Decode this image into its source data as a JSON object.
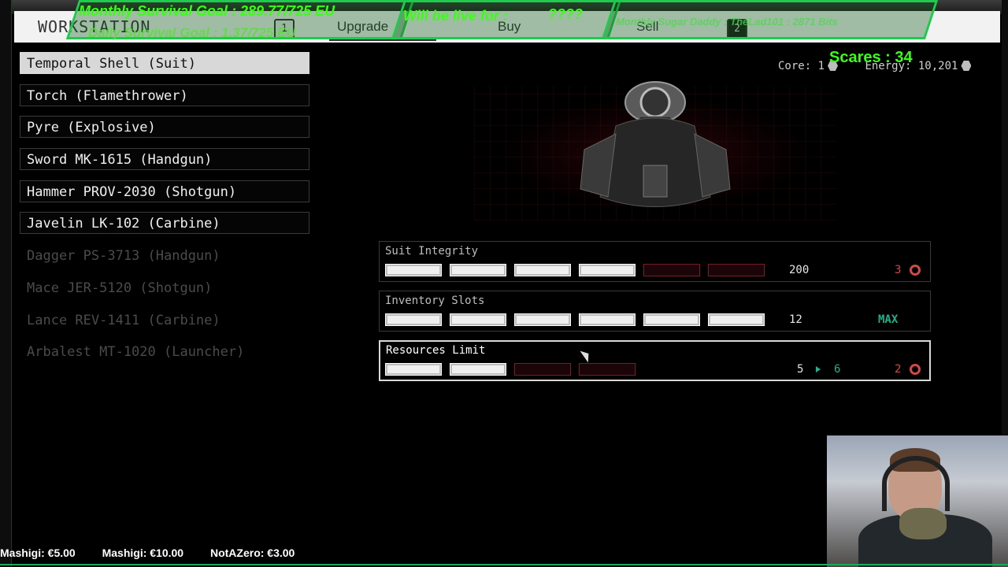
{
  "header": {
    "title": "WORKSTATION",
    "tabs": [
      {
        "key": "1",
        "label": "Upgrade"
      },
      {
        "key": "",
        "label": "Buy"
      },
      {
        "key": "",
        "label": "Sell"
      },
      {
        "key": "2",
        "label": ""
      }
    ]
  },
  "overlays": {
    "monthly_goal": "Monthly Survival Goal : 289.77/725 EU",
    "daily_goal": "Daily Survival Goal : 1.37/725 EU",
    "live_for": "Will be live for :",
    "live_for_value": "????",
    "sugar_daddy": "Monthly Sugar Daddy : TheLad101 : 2871 Bits",
    "scares": "Scares : 34"
  },
  "stats": {
    "core_label": "Core: 1",
    "energy_label": "Energy: 10,201"
  },
  "items": [
    {
      "label": "Temporal Shell (Suit)",
      "state": "selected"
    },
    {
      "label": "Torch (Flamethrower)",
      "state": "owned"
    },
    {
      "label": "Pyre (Explosive)",
      "state": "owned"
    },
    {
      "label": "Sword MK-1615 (Handgun)",
      "state": "owned"
    },
    {
      "label": "Hammer PROV-2030 (Shotgun)",
      "state": "owned"
    },
    {
      "label": "Javelin LK-102 (Carbine)",
      "state": "owned"
    },
    {
      "label": "Dagger PS-3713 (Handgun)",
      "state": "locked"
    },
    {
      "label": "Mace JER-5120 (Shotgun)",
      "state": "locked"
    },
    {
      "label": "Lance REV-1411 (Carbine)",
      "state": "locked"
    },
    {
      "label": "Arbalest MT-1020 (Launcher)",
      "state": "locked"
    }
  ],
  "upgrades": [
    {
      "label": "Suit Integrity",
      "filled": 4,
      "total": 6,
      "value": "200",
      "cost": "3"
    },
    {
      "label": "Inventory Slots",
      "filled": 6,
      "total": 6,
      "value": "12",
      "max": "MAX"
    },
    {
      "label": "Resources Limit",
      "filled": 2,
      "total": 4,
      "value": "5",
      "next": "6",
      "cost": "2"
    }
  ],
  "ticker": [
    "Mashigi: €5.00",
    "Mashigi: €10.00",
    "NotAZero: €3.00"
  ],
  "colors": {
    "accent_green": "#39ff14",
    "teal": "#21b08c",
    "cost_red": "#d04848"
  }
}
